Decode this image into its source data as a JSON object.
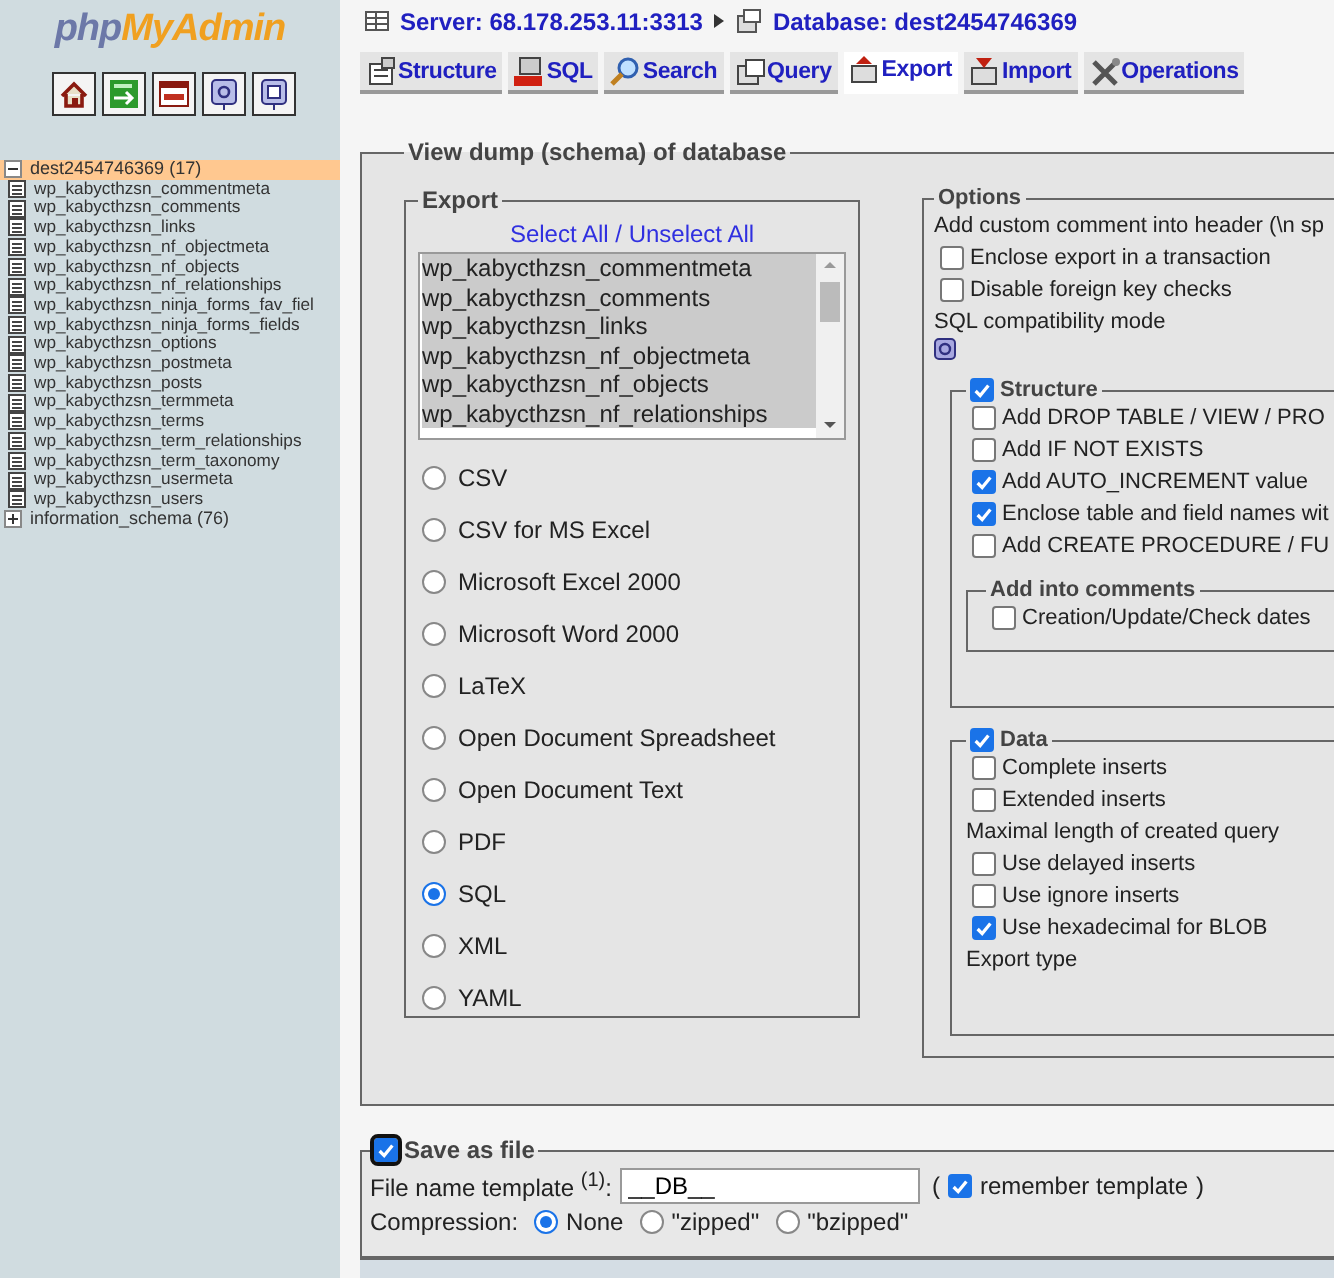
{
  "sidebar": {
    "logo": {
      "part_1": "php",
      "part_2": "MyAdmin"
    },
    "toolbar": [
      {
        "kind": "home"
      },
      {
        "kind": "export"
      },
      {
        "kind": "sql"
      },
      {
        "kind": "help"
      },
      {
        "kind": "docs"
      }
    ],
    "databases": [
      {
        "name": "dest2454746369 (17)",
        "expanded": true,
        "selected": true,
        "children": [
          {
            "name": "wp_kabycthzsn_commentmeta"
          },
          {
            "name": "wp_kabycthzsn_comments"
          },
          {
            "name": "wp_kabycthzsn_links"
          },
          {
            "name": "wp_kabycthzsn_nf_objectmeta"
          },
          {
            "name": "wp_kabycthzsn_nf_objects"
          },
          {
            "name": "wp_kabycthzsn_nf_relationships"
          },
          {
            "name": "wp_kabycthzsn_ninja_forms_fav_fiel"
          },
          {
            "name": "wp_kabycthzsn_ninja_forms_fields"
          },
          {
            "name": "wp_kabycthzsn_options"
          },
          {
            "name": "wp_kabycthzsn_postmeta"
          },
          {
            "name": "wp_kabycthzsn_posts"
          },
          {
            "name": "wp_kabycthzsn_termmeta"
          },
          {
            "name": "wp_kabycthzsn_terms"
          },
          {
            "name": "wp_kabycthzsn_term_relationships"
          },
          {
            "name": "wp_kabycthzsn_term_taxonomy"
          },
          {
            "name": "wp_kabycthzsn_usermeta"
          },
          {
            "name": "wp_kabycthzsn_users"
          }
        ]
      },
      {
        "name": "information_schema (76)",
        "expanded": false,
        "selected": false
      }
    ]
  },
  "breadcrumb": [
    {
      "kind": "server",
      "label": "Server: 68.178.253.11:3313"
    },
    {
      "kind": "database",
      "label": "Database: dest2454746369"
    }
  ],
  "tabs": [
    {
      "kind": "structure",
      "label": "Structure",
      "selected": false
    },
    {
      "kind": "sql",
      "label": "SQL",
      "selected": false
    },
    {
      "kind": "search",
      "label": "Search",
      "selected": false
    },
    {
      "kind": "query",
      "label": "Query",
      "selected": false
    },
    {
      "kind": "export",
      "label": "Export",
      "selected": true
    },
    {
      "kind": "import",
      "label": "Import",
      "selected": false
    },
    {
      "kind": "operations",
      "label": "Operations",
      "selected": false
    }
  ],
  "dump": {
    "legend": "View dump (schema) of database",
    "export": {
      "legend": "Export",
      "select_all": "Select All",
      "separator": "/",
      "unselect_all": "Unselect All",
      "tables": [
        {
          "name": "wp_kabycthzsn_commentmeta",
          "selected": true
        },
        {
          "name": "wp_kabycthzsn_comments",
          "selected": true
        },
        {
          "name": "wp_kabycthzsn_links",
          "selected": true
        },
        {
          "name": "wp_kabycthzsn_nf_objectmeta",
          "selected": true
        },
        {
          "name": "wp_kabycthzsn_nf_objects",
          "selected": true
        },
        {
          "name": "wp_kabycthzsn_nf_relationships",
          "selected": true
        }
      ],
      "formats": [
        {
          "label": "CSV",
          "selected": false
        },
        {
          "label": "CSV for MS Excel",
          "selected": false
        },
        {
          "label": "Microsoft Excel 2000",
          "selected": false
        },
        {
          "label": "Microsoft Word 2000",
          "selected": false
        },
        {
          "label": "LaTeX",
          "selected": false
        },
        {
          "label": "Open Document Spreadsheet",
          "selected": false
        },
        {
          "label": "Open Document Text",
          "selected": false
        },
        {
          "label": "PDF",
          "selected": false
        },
        {
          "label": "SQL",
          "selected": true
        },
        {
          "label": "XML",
          "selected": false
        },
        {
          "label": "YAML",
          "selected": false
        }
      ]
    },
    "options": {
      "legend": "Options",
      "items": [
        {
          "kind": "text",
          "label": "Add custom comment into header (\\n sp"
        },
        {
          "kind": "checkbox",
          "label": "Enclose export in a transaction",
          "checked": false
        },
        {
          "kind": "checkbox",
          "label": "Disable foreign key checks",
          "checked": false
        },
        {
          "kind": "text",
          "label": "SQL compatibility mode"
        },
        {
          "kind": "help"
        }
      ],
      "structure": {
        "legend": "Structure",
        "checked": true,
        "items": [
          {
            "kind": "checkbox",
            "label": "Add DROP TABLE / VIEW / PRO",
            "checked": false
          },
          {
            "kind": "checkbox",
            "label": "Add IF NOT EXISTS",
            "checked": false
          },
          {
            "kind": "checkbox",
            "label": "Add AUTO_INCREMENT value",
            "checked": true
          },
          {
            "kind": "checkbox",
            "label": "Enclose table and field names wit",
            "checked": true
          },
          {
            "kind": "checkbox",
            "label": "Add CREATE PROCEDURE / FU",
            "checked": false
          }
        ],
        "comments": {
          "legend": "Add into comments",
          "items": [
            {
              "kind": "checkbox",
              "label": "Creation/Update/Check dates",
              "checked": false
            }
          ]
        }
      },
      "data": {
        "legend": "Data",
        "checked": true,
        "items": [
          {
            "kind": "checkbox",
            "label": "Complete inserts",
            "checked": false
          },
          {
            "kind": "checkbox",
            "label": "Extended inserts",
            "checked": false
          },
          {
            "kind": "text",
            "label": "Maximal length of created query"
          },
          {
            "kind": "checkbox",
            "label": "Use delayed inserts",
            "checked": false
          },
          {
            "kind": "checkbox",
            "label": "Use ignore inserts",
            "checked": false
          },
          {
            "kind": "checkbox",
            "label": "Use hexadecimal for BLOB",
            "checked": true
          },
          {
            "kind": "text",
            "label": "Export type"
          }
        ]
      }
    }
  },
  "save": {
    "legend": "Save as file",
    "checked": true,
    "template_label": "File name template $^{(1)}$:",
    "template_value": "__DB__",
    "open_paren": "(",
    "remember_label": "remember template",
    "remember_checked": true,
    "close_paren": ")",
    "compression_label": "Compression:",
    "compression": [
      {
        "label": "None",
        "selected": true
      },
      {
        "label": "\"zipped\"",
        "selected": false
      },
      {
        "label": "\"bzipped\"",
        "selected": false
      }
    ]
  }
}
